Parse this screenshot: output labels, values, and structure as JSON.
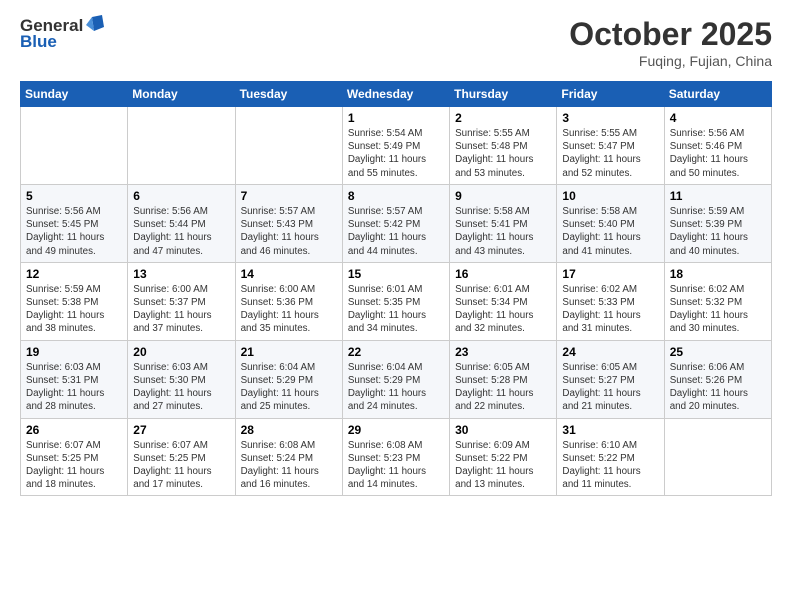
{
  "header": {
    "logo_general": "General",
    "logo_blue": "Blue",
    "month_title": "October 2025",
    "location": "Fuqing, Fujian, China"
  },
  "days_of_week": [
    "Sunday",
    "Monday",
    "Tuesday",
    "Wednesday",
    "Thursday",
    "Friday",
    "Saturday"
  ],
  "weeks": [
    [
      {
        "num": "",
        "info": ""
      },
      {
        "num": "",
        "info": ""
      },
      {
        "num": "",
        "info": ""
      },
      {
        "num": "1",
        "info": "Sunrise: 5:54 AM\nSunset: 5:49 PM\nDaylight: 11 hours\nand 55 minutes."
      },
      {
        "num": "2",
        "info": "Sunrise: 5:55 AM\nSunset: 5:48 PM\nDaylight: 11 hours\nand 53 minutes."
      },
      {
        "num": "3",
        "info": "Sunrise: 5:55 AM\nSunset: 5:47 PM\nDaylight: 11 hours\nand 52 minutes."
      },
      {
        "num": "4",
        "info": "Sunrise: 5:56 AM\nSunset: 5:46 PM\nDaylight: 11 hours\nand 50 minutes."
      }
    ],
    [
      {
        "num": "5",
        "info": "Sunrise: 5:56 AM\nSunset: 5:45 PM\nDaylight: 11 hours\nand 49 minutes."
      },
      {
        "num": "6",
        "info": "Sunrise: 5:56 AM\nSunset: 5:44 PM\nDaylight: 11 hours\nand 47 minutes."
      },
      {
        "num": "7",
        "info": "Sunrise: 5:57 AM\nSunset: 5:43 PM\nDaylight: 11 hours\nand 46 minutes."
      },
      {
        "num": "8",
        "info": "Sunrise: 5:57 AM\nSunset: 5:42 PM\nDaylight: 11 hours\nand 44 minutes."
      },
      {
        "num": "9",
        "info": "Sunrise: 5:58 AM\nSunset: 5:41 PM\nDaylight: 11 hours\nand 43 minutes."
      },
      {
        "num": "10",
        "info": "Sunrise: 5:58 AM\nSunset: 5:40 PM\nDaylight: 11 hours\nand 41 minutes."
      },
      {
        "num": "11",
        "info": "Sunrise: 5:59 AM\nSunset: 5:39 PM\nDaylight: 11 hours\nand 40 minutes."
      }
    ],
    [
      {
        "num": "12",
        "info": "Sunrise: 5:59 AM\nSunset: 5:38 PM\nDaylight: 11 hours\nand 38 minutes."
      },
      {
        "num": "13",
        "info": "Sunrise: 6:00 AM\nSunset: 5:37 PM\nDaylight: 11 hours\nand 37 minutes."
      },
      {
        "num": "14",
        "info": "Sunrise: 6:00 AM\nSunset: 5:36 PM\nDaylight: 11 hours\nand 35 minutes."
      },
      {
        "num": "15",
        "info": "Sunrise: 6:01 AM\nSunset: 5:35 PM\nDaylight: 11 hours\nand 34 minutes."
      },
      {
        "num": "16",
        "info": "Sunrise: 6:01 AM\nSunset: 5:34 PM\nDaylight: 11 hours\nand 32 minutes."
      },
      {
        "num": "17",
        "info": "Sunrise: 6:02 AM\nSunset: 5:33 PM\nDaylight: 11 hours\nand 31 minutes."
      },
      {
        "num": "18",
        "info": "Sunrise: 6:02 AM\nSunset: 5:32 PM\nDaylight: 11 hours\nand 30 minutes."
      }
    ],
    [
      {
        "num": "19",
        "info": "Sunrise: 6:03 AM\nSunset: 5:31 PM\nDaylight: 11 hours\nand 28 minutes."
      },
      {
        "num": "20",
        "info": "Sunrise: 6:03 AM\nSunset: 5:30 PM\nDaylight: 11 hours\nand 27 minutes."
      },
      {
        "num": "21",
        "info": "Sunrise: 6:04 AM\nSunset: 5:29 PM\nDaylight: 11 hours\nand 25 minutes."
      },
      {
        "num": "22",
        "info": "Sunrise: 6:04 AM\nSunset: 5:29 PM\nDaylight: 11 hours\nand 24 minutes."
      },
      {
        "num": "23",
        "info": "Sunrise: 6:05 AM\nSunset: 5:28 PM\nDaylight: 11 hours\nand 22 minutes."
      },
      {
        "num": "24",
        "info": "Sunrise: 6:05 AM\nSunset: 5:27 PM\nDaylight: 11 hours\nand 21 minutes."
      },
      {
        "num": "25",
        "info": "Sunrise: 6:06 AM\nSunset: 5:26 PM\nDaylight: 11 hours\nand 20 minutes."
      }
    ],
    [
      {
        "num": "26",
        "info": "Sunrise: 6:07 AM\nSunset: 5:25 PM\nDaylight: 11 hours\nand 18 minutes."
      },
      {
        "num": "27",
        "info": "Sunrise: 6:07 AM\nSunset: 5:25 PM\nDaylight: 11 hours\nand 17 minutes."
      },
      {
        "num": "28",
        "info": "Sunrise: 6:08 AM\nSunset: 5:24 PM\nDaylight: 11 hours\nand 16 minutes."
      },
      {
        "num": "29",
        "info": "Sunrise: 6:08 AM\nSunset: 5:23 PM\nDaylight: 11 hours\nand 14 minutes."
      },
      {
        "num": "30",
        "info": "Sunrise: 6:09 AM\nSunset: 5:22 PM\nDaylight: 11 hours\nand 13 minutes."
      },
      {
        "num": "31",
        "info": "Sunrise: 6:10 AM\nSunset: 5:22 PM\nDaylight: 11 hours\nand 11 minutes."
      },
      {
        "num": "",
        "info": ""
      }
    ]
  ]
}
